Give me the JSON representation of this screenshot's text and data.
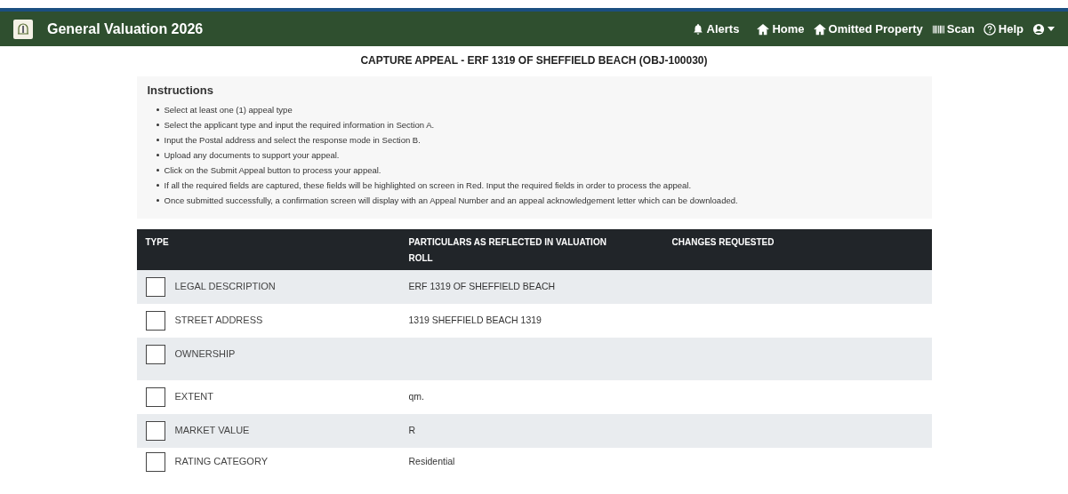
{
  "app_title": "General Valuation 2026",
  "nav": [
    {
      "kind": "bell",
      "label": "Alerts"
    },
    {
      "kind": "home",
      "label": "Home"
    },
    {
      "kind": "home",
      "label": "Omitted Property"
    },
    {
      "kind": "barcode",
      "label": "Scan"
    },
    {
      "kind": "help",
      "label": "Help"
    }
  ],
  "page_title": "CAPTURE APPEAL - ERF 1319 OF SHEFFIELD BEACH (OBJ-100030)",
  "instructions": {
    "title": "Instructions",
    "items": [
      "Select at least one (1) appeal type",
      "Select the applicant type and input the required information in Section A.",
      "Input the Postal address and select the response mode in Section B.",
      "Upload any documents to support your appeal.",
      "Click on the Submit Appeal button to process your appeal.",
      "If all the required fields are captured, these fields will be highlighted on screen in Red. Input the required fields in order to process the appeal.",
      "Once submitted successfully, a confirmation screen will display with an Appeal Number and an appeal acknowledgement letter which can be downloaded."
    ]
  },
  "table": {
    "columns": [
      "TYPE",
      "PARTICULARS AS REFLECTED IN VALUATION ROLL",
      "CHANGES REQUESTED"
    ],
    "rows": [
      {
        "type": "LEGAL DESCRIPTION",
        "checked": false,
        "particulars": [
          "ERF 1319 OF SHEFFIELD BEACH"
        ]
      },
      {
        "type": "STREET ADDRESS",
        "checked": false,
        "particulars": [
          "1319 SHEFFIELD BEACH 1319"
        ]
      },
      {
        "type": "OWNERSHIP",
        "checked": false
      },
      {
        "type": "EXTENT",
        "checked": false,
        "particulars": [
          "qm."
        ]
      },
      {
        "type": "MARKET VALUE",
        "checked": false,
        "particulars": [
          "R"
        ]
      },
      {
        "type": "RATING CATEGORY",
        "checked": false,
        "particulars": [
          "Residential"
        ]
      }
    ]
  }
}
